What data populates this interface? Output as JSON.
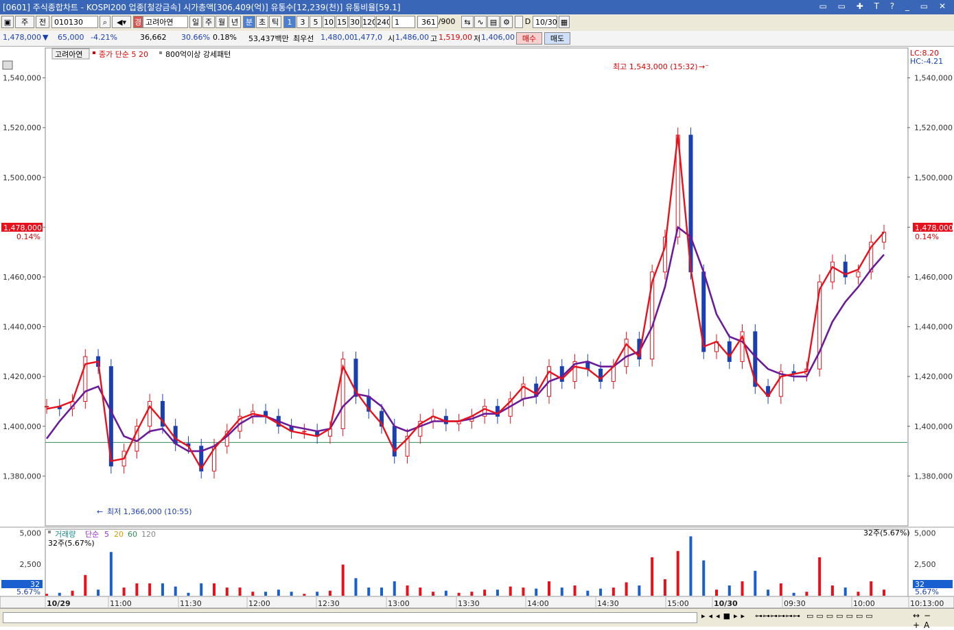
{
  "window": {
    "title": "[0601] 주식종합차트 - KOSPI200 업종[철강금속] 시가총액[306,409(억)] 유통수[12,239(천)] 유통비율[59.1]",
    "controls": "▭ ▭ ✚ T ? _ ▭ ✕"
  },
  "toolbar": {
    "mode_1": "주",
    "mode_2": "전",
    "code": "010130",
    "name_tag": "경",
    "stock_name": "고려아연",
    "periods": [
      "일",
      "주",
      "월",
      "년",
      "분",
      "초",
      "틱"
    ],
    "active_period": "분",
    "intervals": [
      "1",
      "3",
      "5",
      "10",
      "15",
      "30",
      "120",
      "240"
    ],
    "active_interval": "1",
    "multiplier": "1",
    "count": "361",
    "count_total": "/900",
    "d_label": "D",
    "date": "10/30"
  },
  "quote": {
    "price": "1,478,000",
    "direction": "▼",
    "change": "65,000",
    "change_pct": "-4.21%",
    "volume": "36,662",
    "ratio": "30.66%",
    "turnover": "0.18%",
    "amount": "53,437백만",
    "order_label": "최우선",
    "ask": "1,480,00",
    "bid": "1,477,0",
    "open_label": "시",
    "open": "1,486,00",
    "high_label": "고",
    "high": "1,519,00",
    "low_label": "저",
    "low": "1,406,00",
    "buy_button": "매수",
    "sell_button": "매도"
  },
  "price_panel": {
    "legend_name": "고려아연",
    "legend_ma": "종가 단순 5  20",
    "legend_pattern": "800억이상 강세패턴",
    "high_annotation": "최고 1,543,000 (15:32)",
    "low_annotation": "최저 1,366,000 (10:55)",
    "lc_label": "LC:8.20",
    "hc_label": "HC:-4.21",
    "current_price_tag": "1,478,000",
    "current_pct_tag": "0.14%",
    "ref_line_value": 1393500
  },
  "volume_panel": {
    "legend_label": "거래량",
    "legend_type": "단순",
    "legend_periods": [
      "5",
      "20",
      "60",
      "120"
    ],
    "sub_label": "32주(5.67%)",
    "right_label": "32주(5.67%)",
    "current_tag": "32",
    "current_pct_tag": "5.67%"
  },
  "chart_data": [
    {
      "type": "candlestick",
      "y_ticks": [
        "1,380,000",
        "1,400,000",
        "1,420,000",
        "1,440,000",
        "1,460,000",
        "1,480,000",
        "1,500,000",
        "1,520,000",
        "1,540,000"
      ],
      "ylim": [
        1360000,
        1552000
      ],
      "x_ticks": [
        "10/29",
        "11:00",
        "11:30",
        "12:00",
        "12:30",
        "13:00",
        "13:30",
        "14:00",
        "14:30",
        "15:00",
        "10/30",
        "09:30",
        "10:00",
        "10:13:00"
      ],
      "close_series": [
        1408000,
        1407000,
        1410000,
        1428000,
        1424000,
        1384000,
        1390000,
        1400000,
        1410000,
        1400000,
        1393000,
        1392000,
        1382000,
        1392000,
        1398000,
        1404000,
        1406000,
        1404000,
        1400000,
        1398000,
        1398000,
        1396000,
        1399000,
        1427000,
        1412000,
        1406000,
        1400000,
        1388000,
        1396000,
        1402000,
        1404000,
        1401000,
        1402000,
        1404000,
        1408000,
        1404000,
        1411000,
        1417000,
        1412000,
        1424000,
        1418000,
        1426000,
        1423000,
        1418000,
        1424000,
        1435000,
        1427000,
        1462000,
        1476000,
        1517000,
        1462000,
        1430000,
        1434000,
        1426000,
        1438000,
        1416000,
        1412000,
        1422000,
        1421000,
        1423000,
        1458000,
        1466000,
        1460000,
        1462000,
        1474000,
        1478000
      ],
      "ma5_series": [
        1407000,
        1408000,
        1410000,
        1425000,
        1426000,
        1386000,
        1387000,
        1398000,
        1408000,
        1402000,
        1395000,
        1392000,
        1383000,
        1391000,
        1397000,
        1403000,
        1405000,
        1404000,
        1401000,
        1398000,
        1397000,
        1396000,
        1399000,
        1424000,
        1414000,
        1407000,
        1401000,
        1390000,
        1395000,
        1401000,
        1404000,
        1402000,
        1402000,
        1404000,
        1407000,
        1405000,
        1410000,
        1416000,
        1413000,
        1422000,
        1419000,
        1424000,
        1423000,
        1419000,
        1424000,
        1433000,
        1428000,
        1458000,
        1472000,
        1517000,
        1463000,
        1432000,
        1434000,
        1428000,
        1436000,
        1418000,
        1412000,
        1420000,
        1421000,
        1422000,
        1455000,
        1464000,
        1461000,
        1463000,
        1472000,
        1478000
      ],
      "ma20_series": [
        1395000,
        1402000,
        1408000,
        1414000,
        1416000,
        1406000,
        1396000,
        1394000,
        1398000,
        1399000,
        1393000,
        1390000,
        1390000,
        1392000,
        1396000,
        1401000,
        1404000,
        1404000,
        1402000,
        1400000,
        1399000,
        1398000,
        1399000,
        1408000,
        1413000,
        1412000,
        1408000,
        1400000,
        1398000,
        1400000,
        1402000,
        1402000,
        1402000,
        1403000,
        1405000,
        1405000,
        1408000,
        1411000,
        1412000,
        1418000,
        1420000,
        1425000,
        1426000,
        1424000,
        1424000,
        1428000,
        1430000,
        1440000,
        1456000,
        1480000,
        1476000,
        1462000,
        1445000,
        1436000,
        1434000,
        1428000,
        1423000,
        1421000,
        1420000,
        1420000,
        1430000,
        1442000,
        1450000,
        1456000,
        1463000,
        1469000
      ]
    },
    {
      "type": "bar",
      "y_ticks": [
        "2,500",
        "5,000"
      ],
      "ylim": [
        0,
        5300
      ]
    }
  ]
}
